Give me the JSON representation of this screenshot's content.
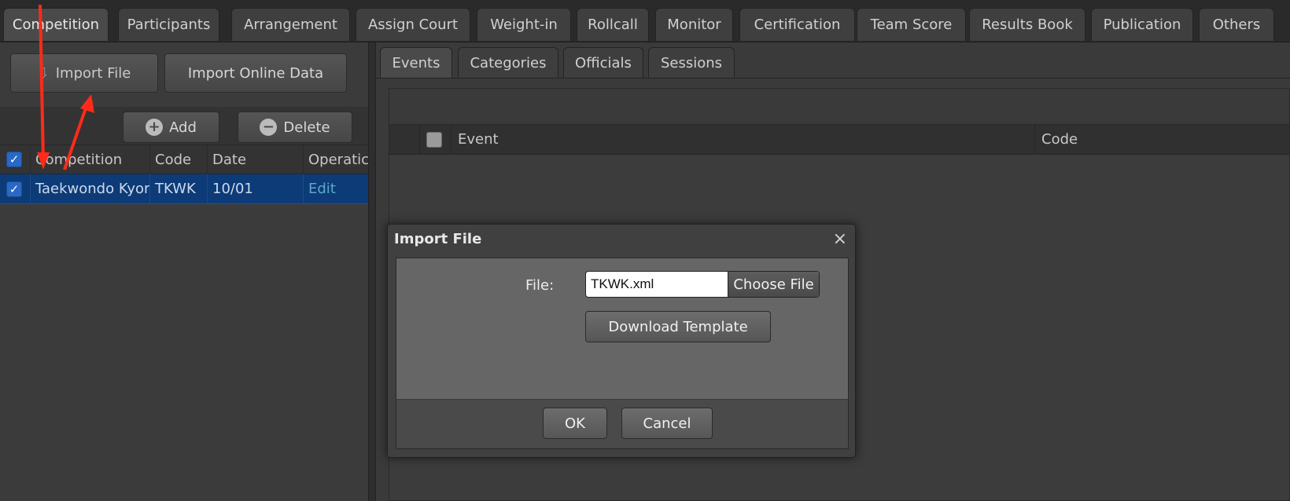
{
  "top_tabs": [
    "Competition",
    "Participants",
    "Arrangement",
    "Assign Court",
    "Weight-in",
    "Rollcall",
    "Monitor",
    "Certification",
    "Team Score",
    "Results Book",
    "Publication",
    "Others"
  ],
  "left": {
    "import_file": "Import File",
    "import_online": "Import Online Data",
    "add": "Add",
    "delete": "Delete",
    "columns": {
      "competition": "Competition",
      "code": "Code",
      "date": "Date",
      "operation": "Operatic"
    },
    "row": {
      "competition": "Taekwondo Kyor",
      "code": "TKWK",
      "date": "10/01",
      "operation": "Edit"
    }
  },
  "right": {
    "sub_tabs": [
      "Events",
      "Categories",
      "Officials",
      "Sessions"
    ],
    "columns": {
      "event": "Event",
      "code": "Code"
    }
  },
  "modal": {
    "title": "Import File",
    "close": "×",
    "file_label": "File:",
    "file_value": "TKWK.xml",
    "choose_file": "Choose File",
    "download_template": "Download Template",
    "ok": "OK",
    "cancel": "Cancel"
  },
  "annotation_color": "#ff2a1a"
}
